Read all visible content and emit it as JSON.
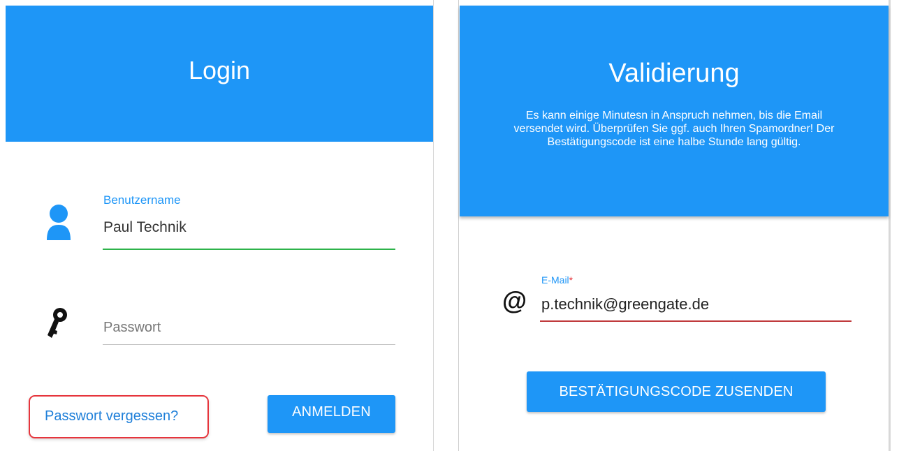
{
  "login": {
    "title": "Login",
    "username": {
      "label": "Benutzername",
      "value": "Paul Technik",
      "icon": "user-icon"
    },
    "password": {
      "placeholder": "Passwort",
      "icon": "key-icon"
    },
    "forgot_link": "Passwort vergessen?",
    "submit_label": "ANMELDEN"
  },
  "validation": {
    "title": "Validierung",
    "description": "Es kann einige Minutesn in Anspruch nehmen, bis die Email versendet wird. Überprüfen Sie ggf. auch Ihren Spamordner! Der Bestätigungscode ist eine halbe Stunde lang gültig.",
    "email": {
      "label": "E-Mail",
      "required_marker": "*",
      "value": "p.technik@greengate.de",
      "icon": "at-icon"
    },
    "submit_label": "BESTÄTIGUNGSCODE ZUSENDEN"
  },
  "colors": {
    "accent": "#1e96f7",
    "valid": "#2db34a",
    "invalid": "#c0393b",
    "highlight": "#e6353c"
  }
}
